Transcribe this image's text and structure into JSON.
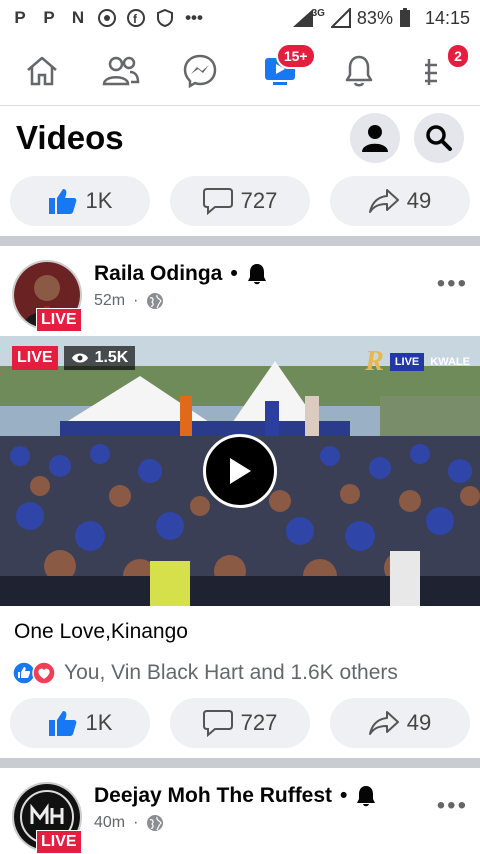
{
  "status_bar": {
    "app_icons": [
      "P",
      "P",
      "N"
    ],
    "battery": "83%",
    "time": "14:15",
    "network": "3G"
  },
  "nav": {
    "tabs": [
      {
        "name": "home-icon"
      },
      {
        "name": "friends-icon"
      },
      {
        "name": "messenger-icon"
      },
      {
        "name": "watch-icon",
        "badge": "15+"
      },
      {
        "name": "bell-icon"
      },
      {
        "name": "menu-icon",
        "badge": "2"
      }
    ]
  },
  "page": {
    "title": "Videos"
  },
  "top_actions": {
    "likes": "1K",
    "comments": "727",
    "shares": "49"
  },
  "post1": {
    "author": "Raila Odinga",
    "time": "52m",
    "live_label": "LIVE",
    "video_live": "LIVE",
    "viewers": "1.5K",
    "brand_live": "LIVE",
    "brand_place": "KWALE",
    "caption": "One Love,Kinango",
    "reactions_text": "You, Vin Black Hart and 1.6K others",
    "likes": "1K",
    "comments": "727",
    "shares": "49"
  },
  "post2": {
    "author": "Deejay Moh The Ruffest",
    "time": "40m",
    "live_label": "LIVE"
  },
  "colors": {
    "accent": "#1877f2",
    "live": "#e41e3f"
  }
}
